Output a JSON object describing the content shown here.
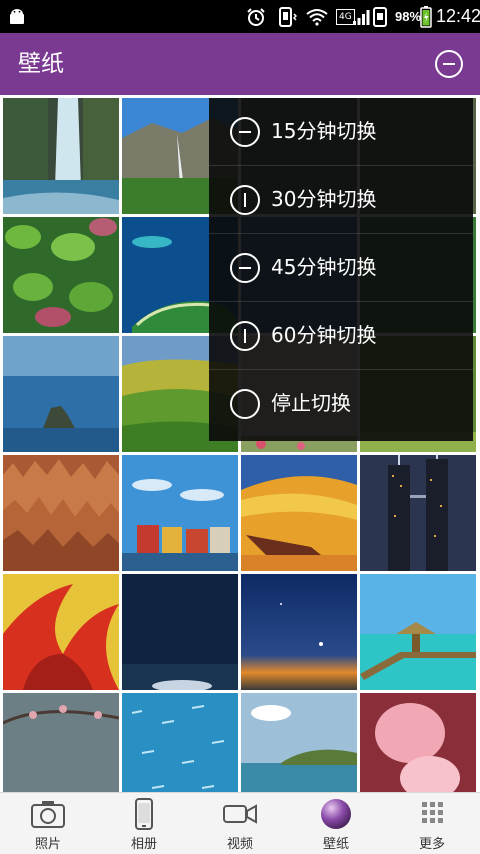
{
  "status_bar": {
    "network": "4G",
    "battery": "98%",
    "time": "12:42"
  },
  "action_bar": {
    "title": "壁纸",
    "menu_icon": "minus-circle-icon"
  },
  "colors": {
    "accent": "#7b3a91",
    "popup_bg": "#0a0a0a"
  },
  "popup_menu": {
    "items": [
      {
        "label": "15分钟切换",
        "icon": "minus-circle-icon"
      },
      {
        "label": "30分钟切换",
        "icon": "vertical-bar-circle-icon"
      },
      {
        "label": "45分钟切换",
        "icon": "minus-circle-icon"
      },
      {
        "label": "60分钟切换",
        "icon": "vertical-bar-circle-icon"
      },
      {
        "label": "停止切换",
        "icon": "empty-circle-icon"
      }
    ]
  },
  "bottom_nav": {
    "items": [
      {
        "label": "照片",
        "icon": "camera-icon"
      },
      {
        "label": "相册",
        "icon": "phone-icon"
      },
      {
        "label": "视频",
        "icon": "video-camera-icon"
      },
      {
        "label": "壁纸",
        "icon": "wallpaper-sphere-icon",
        "selected": true
      },
      {
        "label": "更多",
        "icon": "grid-dots-icon"
      }
    ]
  }
}
